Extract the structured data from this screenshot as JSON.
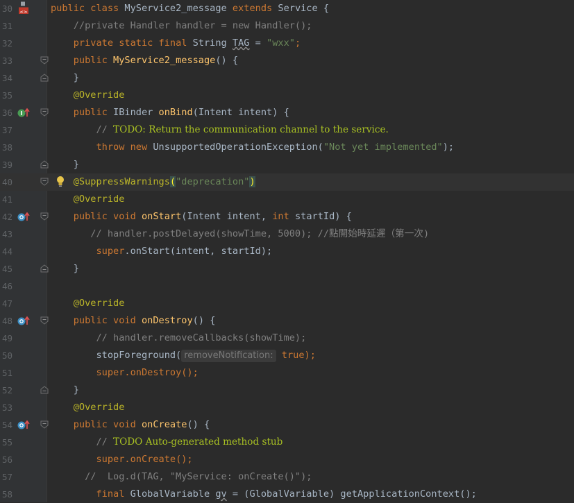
{
  "editor": {
    "lines": [
      {
        "num": "30",
        "icon": "android-class-icon",
        "fold": "none"
      },
      {
        "num": "31",
        "icon": "",
        "fold": "none"
      },
      {
        "num": "32",
        "icon": "",
        "fold": "none"
      },
      {
        "num": "33",
        "icon": "",
        "fold": "open"
      },
      {
        "num": "34",
        "icon": "",
        "fold": "close"
      },
      {
        "num": "35",
        "icon": "",
        "fold": "none"
      },
      {
        "num": "36",
        "icon": "implements-method-icon",
        "fold": "open"
      },
      {
        "num": "37",
        "icon": "",
        "fold": "none"
      },
      {
        "num": "38",
        "icon": "",
        "fold": "none"
      },
      {
        "num": "39",
        "icon": "",
        "fold": "close"
      },
      {
        "num": "40",
        "icon": "",
        "fold": "open"
      },
      {
        "num": "41",
        "icon": "",
        "fold": "none"
      },
      {
        "num": "42",
        "icon": "override-method-icon",
        "fold": "open"
      },
      {
        "num": "43",
        "icon": "",
        "fold": "none"
      },
      {
        "num": "44",
        "icon": "",
        "fold": "none"
      },
      {
        "num": "45",
        "icon": "",
        "fold": "close"
      },
      {
        "num": "46",
        "icon": "",
        "fold": "none"
      },
      {
        "num": "47",
        "icon": "",
        "fold": "none"
      },
      {
        "num": "48",
        "icon": "override-method-icon",
        "fold": "open"
      },
      {
        "num": "49",
        "icon": "",
        "fold": "none"
      },
      {
        "num": "50",
        "icon": "",
        "fold": "none"
      },
      {
        "num": "51",
        "icon": "",
        "fold": "none"
      },
      {
        "num": "52",
        "icon": "",
        "fold": "close"
      },
      {
        "num": "53",
        "icon": "",
        "fold": "none"
      },
      {
        "num": "54",
        "icon": "override-method-icon",
        "fold": "open"
      },
      {
        "num": "55",
        "icon": "",
        "fold": "none"
      },
      {
        "num": "56",
        "icon": "",
        "fold": "none"
      },
      {
        "num": "57",
        "icon": "",
        "fold": "none"
      },
      {
        "num": "58",
        "icon": "",
        "fold": "none"
      }
    ],
    "code": {
      "l30": {
        "kw1": "public class ",
        "name": "MyService2_message ",
        "kw2": "extends ",
        "rest": "Service {"
      },
      "l31": {
        "indent": "    ",
        "cmt": "//private Handler handler = new Handler();"
      },
      "l32": {
        "indent": "    ",
        "kw": "private static final ",
        "type": "String ",
        "name": "TAG",
        "eq": " = ",
        "str": "\"wxx\"",
        "end": ";"
      },
      "l33": {
        "indent": "    ",
        "kw": "public ",
        "fn": "MyService2_message",
        "rest": "() {"
      },
      "l34": {
        "indent": "    ",
        "rest": "}"
      },
      "l35": {
        "indent": "    ",
        "ann": "@Override"
      },
      "l36": {
        "indent": "    ",
        "kw": "public ",
        "type": "IBinder ",
        "fn": "onBind",
        "rest": "(Intent intent) {"
      },
      "l37": {
        "indent": "        ",
        "cmt": "// ",
        "todo": "TODO: Return the communication channel to the service."
      },
      "l38": {
        "indent": "        ",
        "kw1": "throw ",
        "kw2": "new ",
        "type": "UnsupportedOperationException(",
        "str": "\"Not yet implemented\"",
        "end": ");"
      },
      "l39": {
        "indent": "    ",
        "rest": "}"
      },
      "l40": {
        "indent": "    ",
        "ann": "@SuppressWarnings",
        "open": "(",
        "str": "\"deprecation\"",
        "close": ")"
      },
      "l41": {
        "indent": "    ",
        "ann": "@Override"
      },
      "l42": {
        "indent": "    ",
        "kw": "public void ",
        "fn": "onStart",
        "p1": "(Intent intent, ",
        "kw2": "int ",
        "p2": "startId) {"
      },
      "l43": {
        "indent": "       ",
        "cmt": "// handler.postDelayed(showTime, 5000); //點開始時延遲（第一次)"
      },
      "l44": {
        "indent": "        ",
        "kw": "super",
        "rest": ".onStart(intent, startId);"
      },
      "l45": {
        "indent": "    ",
        "rest": "}"
      },
      "l46": {
        "indent": "",
        "rest": ""
      },
      "l47": {
        "indent": "    ",
        "ann": "@Override"
      },
      "l48": {
        "indent": "    ",
        "kw": "public void ",
        "fn": "onDestroy",
        "rest": "() {"
      },
      "l49": {
        "indent": "        ",
        "cmt": "// handler.removeCallbacks(showTime);"
      },
      "l50": {
        "indent": "        ",
        "call": "stopForeground(",
        "hint": "removeNotification:",
        "kw": " true",
        "end": ");"
      },
      "l51": {
        "indent": "        ",
        "kw": "super",
        "rest": ".onDestroy();"
      },
      "l52": {
        "indent": "    ",
        "rest": "}"
      },
      "l53": {
        "indent": "    ",
        "ann": "@Override"
      },
      "l54": {
        "indent": "    ",
        "kw": "public void ",
        "fn": "onCreate",
        "rest": "() {"
      },
      "l55": {
        "indent": "        ",
        "cmt": "// ",
        "todo": "TODO Auto-generated method stub"
      },
      "l56": {
        "indent": "        ",
        "kw": "super",
        "rest": ".onCreate();"
      },
      "l57": {
        "indent": "      ",
        "cmt": "//  Log.d(TAG, \"MyService: onCreate()\");"
      },
      "l58": {
        "indent": "        ",
        "kw": "final ",
        "type": "GlobalVariable ",
        "var": "gv",
        "rest": " = (GlobalVariable) getApplicationContext();"
      }
    }
  },
  "colors": {
    "background": "#2b2b2b",
    "gutter": "#313335",
    "keyword": "#cc7832",
    "string": "#6a8759",
    "comment": "#808080",
    "todo": "#a8c023",
    "annotation": "#bbb529",
    "method": "#ffc66d"
  }
}
